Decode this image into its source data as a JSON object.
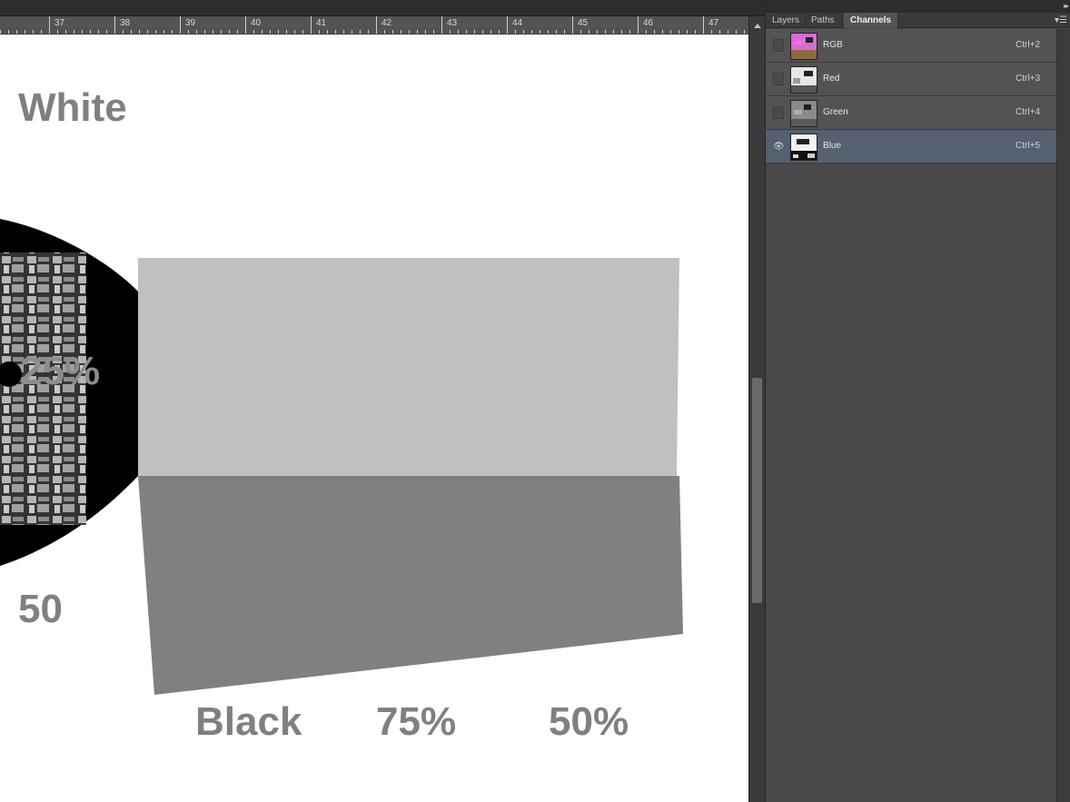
{
  "ruler": {
    "labels": [
      "37",
      "38",
      "39",
      "40",
      "41",
      "42",
      "43",
      "44",
      "45",
      "46",
      "47"
    ]
  },
  "canvas": {
    "texts": {
      "white": "White",
      "pct25": "25%",
      "fifty": "50",
      "black": "Black",
      "pct75": "75%",
      "pct50": "50%"
    }
  },
  "panel": {
    "tabs": [
      {
        "label": "Layers",
        "active": false
      },
      {
        "label": "Paths",
        "active": false
      },
      {
        "label": "Channels",
        "active": true
      }
    ],
    "channels": [
      {
        "name": "RGB",
        "shortcut": "Ctrl+2",
        "visible": false,
        "selected": false,
        "thumb_color": "#d46cd8"
      },
      {
        "name": "Red",
        "shortcut": "Ctrl+3",
        "visible": false,
        "selected": false,
        "thumb_color": "#e6e6e6"
      },
      {
        "name": "Green",
        "shortcut": "Ctrl+4",
        "visible": false,
        "selected": false,
        "thumb_color": "#8a8a8a"
      },
      {
        "name": "Blue",
        "shortcut": "Ctrl+5",
        "visible": true,
        "selected": true,
        "thumb_color": "#f2f2f2"
      }
    ]
  },
  "colors": {
    "panel_bg": "#484848",
    "row_bg": "#535353",
    "selected_row": "#536170",
    "canvas_text": "#808080",
    "light_gray": "#c0c0c0",
    "mid_gray": "#808080"
  },
  "icons": {
    "eye": "eye-icon",
    "panel_menu": "panel-menu-icon",
    "collapse": "double-chevron-icon"
  }
}
